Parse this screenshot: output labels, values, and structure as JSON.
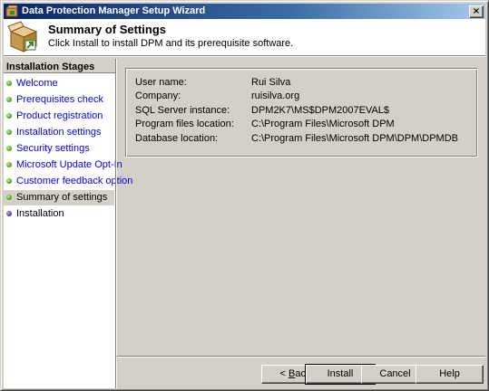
{
  "window": {
    "title": "Data Protection Manager Setup Wizard",
    "close_glyph": "×"
  },
  "header": {
    "title": "Summary of Settings",
    "subtitle": "Click Install to install DPM and its prerequisite software.",
    "icon": "setup-box-icon"
  },
  "sidebar": {
    "heading": "Installation Stages",
    "items": [
      {
        "label": "Welcome",
        "state": "done"
      },
      {
        "label": "Prerequisites check",
        "state": "done"
      },
      {
        "label": "Product registration",
        "state": "done"
      },
      {
        "label": "Installation settings",
        "state": "done"
      },
      {
        "label": "Security settings",
        "state": "done"
      },
      {
        "label": "Microsoft Update Opt-In",
        "state": "done"
      },
      {
        "label": "Customer feedback option",
        "state": "done"
      },
      {
        "label": "Summary of settings",
        "state": "current"
      },
      {
        "label": "Installation",
        "state": "pending"
      }
    ]
  },
  "summary": {
    "rows": [
      {
        "key": "User name:",
        "value": "Rui Silva"
      },
      {
        "key": "Company:",
        "value": "ruisilva.org"
      },
      {
        "key": "SQL Server instance:",
        "value": "DPM2K7\\MS$DPM2007EVAL$"
      },
      {
        "key": "Program files location:",
        "value": "C:\\Program Files\\Microsoft DPM"
      },
      {
        "key": "Database location:",
        "value": "C:\\Program Files\\Microsoft DPM\\DPM\\DPMDB"
      }
    ]
  },
  "buttons": {
    "back_prefix": "< ",
    "back_mnemonic": "B",
    "back_rest": "ack",
    "install": "Install",
    "cancel": "Cancel",
    "help": "Help"
  },
  "colors": {
    "link": "#0000ee",
    "titlebar_start": "#0a246a",
    "titlebar_end": "#a6caf0",
    "dialog_bg": "#d4d0c8",
    "done_dot": "#3c9a12",
    "pending_dot": "#3b2fa5"
  }
}
